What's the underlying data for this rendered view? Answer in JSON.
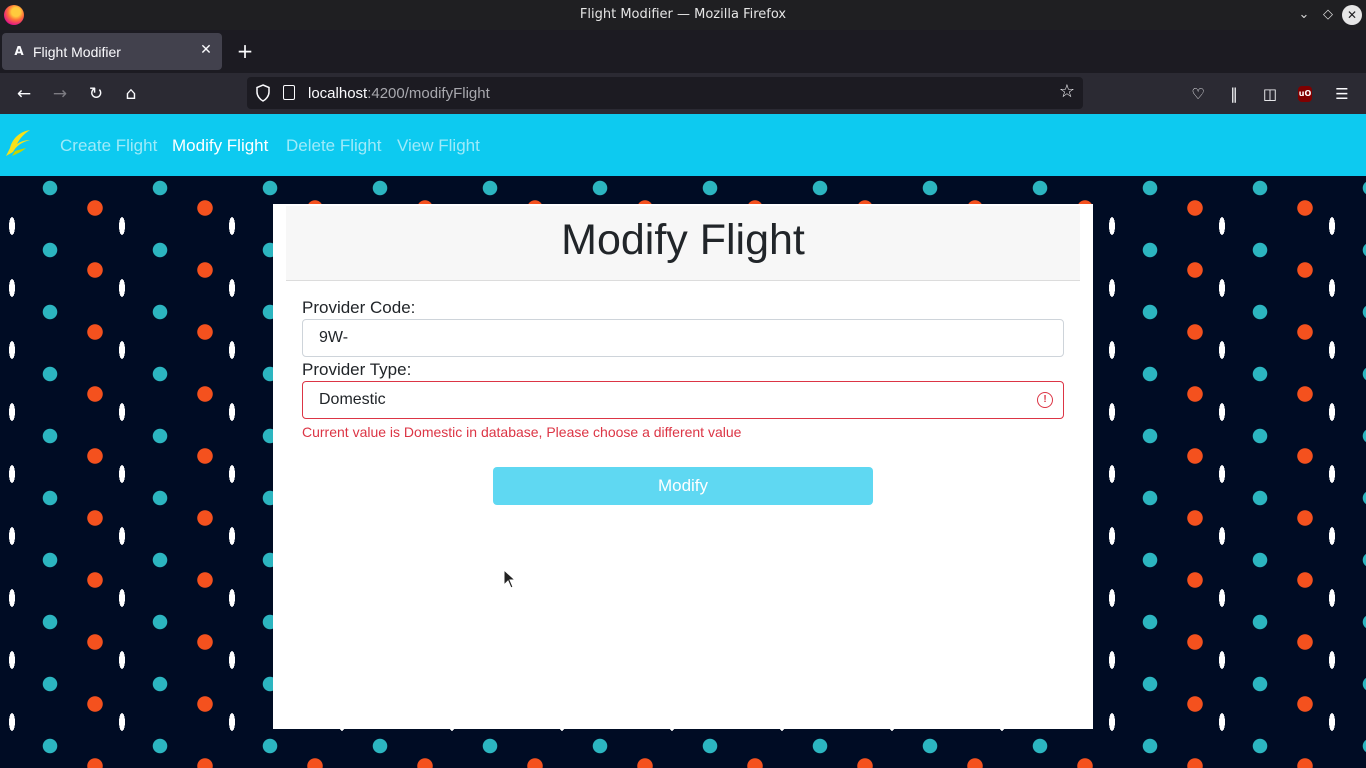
{
  "window": {
    "title": "Flight Modifier — Mozilla Firefox"
  },
  "tabs": [
    {
      "label": "Flight Modifier",
      "icon": "angular-icon",
      "active": true
    }
  ],
  "toolbar": {
    "url_host": "localhost",
    "url_path": ":4200/modifyFlight"
  },
  "app": {
    "nav": [
      {
        "label": "Create Flight",
        "active": false
      },
      {
        "label": "Modify Flight",
        "active": true
      },
      {
        "label": "Delete Flight",
        "active": false
      },
      {
        "label": "View Flight",
        "active": false
      }
    ],
    "accent_color": "#0dcaf0"
  },
  "form": {
    "title": "Modify Flight",
    "provider_code_label": "Provider Code:",
    "provider_code_value": "9W-",
    "provider_type_label": "Provider Type:",
    "provider_type_value": "Domestic",
    "error_message": "Current value is Domestic in database, Please choose a different value",
    "submit_label": "Modify",
    "error_color": "#dc3545"
  }
}
